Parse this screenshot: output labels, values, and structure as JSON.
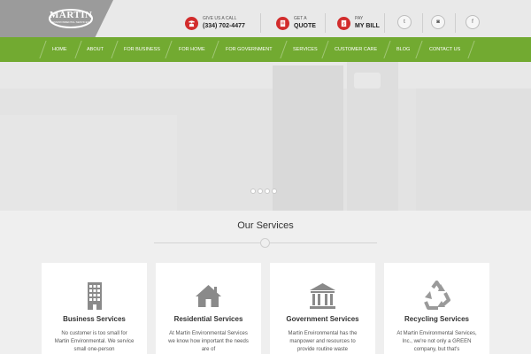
{
  "brand": {
    "logo_text": "MARTIN",
    "logo_sub": "ENVIRONMENTAL SERVICES"
  },
  "contact": [
    {
      "small": "GIVE US A CALL",
      "big": "(334) 702-4477",
      "icon": "phone-icon"
    },
    {
      "small": "GET A",
      "big": "QUOTE",
      "icon": "document-icon"
    },
    {
      "small": "PAY",
      "big": "MY BILL",
      "icon": "bill-icon"
    }
  ],
  "social": [
    {
      "icon": "twitter-icon",
      "glyph": "t"
    },
    {
      "icon": "instagram-icon",
      "glyph": "◙"
    },
    {
      "icon": "facebook-icon",
      "glyph": "f"
    }
  ],
  "nav": [
    "HOME",
    "ABOUT",
    "FOR BUSINESS",
    "FOR HOME",
    "FOR GOVERNMENT",
    "SERVICES",
    "CUSTOMER CARE",
    "BLOG",
    "CONTACT US"
  ],
  "services": {
    "title": "Our Services",
    "cards": [
      {
        "title": "Business Services",
        "desc": "No customer is too small for Martin Environmental. We service small one-person",
        "icon": "office-building-icon"
      },
      {
        "title": "Residential Services",
        "desc": "At Martin Environmental Services we know how important the needs are of",
        "icon": "house-icon"
      },
      {
        "title": "Government Services",
        "desc": "Martin Environmental has the manpower and resources to provide routine waste",
        "icon": "government-building-icon"
      },
      {
        "title": "Recycling Services",
        "desc": "At Martin Environmental Services, Inc., we're not only a GREEN company, but that's",
        "icon": "recycle-icon"
      }
    ]
  },
  "colors": {
    "accent_green": "#72aa31",
    "accent_red": "#d22c2c",
    "logo_gray": "#9b9b9b"
  }
}
